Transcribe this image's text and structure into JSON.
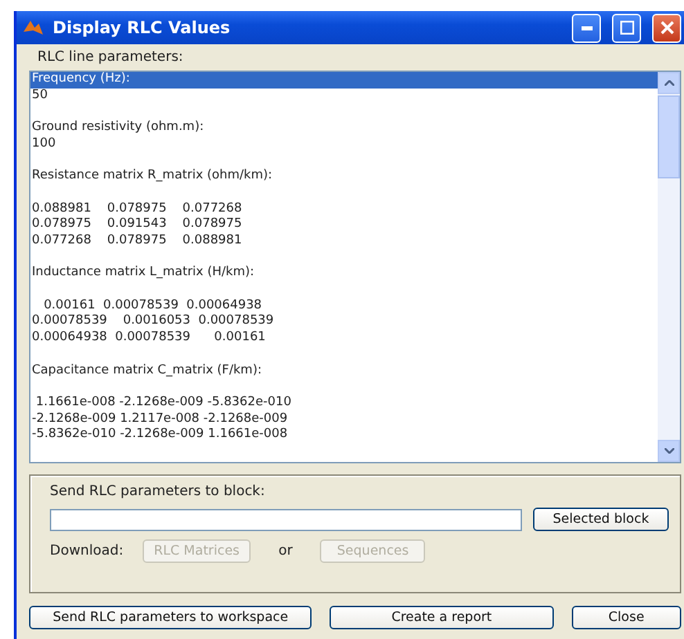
{
  "window": {
    "title": "Display RLC Values"
  },
  "listbox": {
    "label": "RLC line parameters:",
    "items": [
      {
        "text": "Frequency (Hz):",
        "selected": true,
        "space_before": false
      },
      {
        "text": "50",
        "selected": false,
        "space_before": false
      },
      {
        "text": "Ground resistivity (ohm.m):",
        "selected": false,
        "space_before": true
      },
      {
        "text": "100",
        "selected": false,
        "space_before": false
      },
      {
        "text": "Resistance matrix R_matrix (ohm/km):",
        "selected": false,
        "space_before": true
      },
      {
        "text": "0.088981    0.078975    0.077268",
        "selected": false,
        "space_before": true
      },
      {
        "text": "0.078975    0.091543    0.078975",
        "selected": false,
        "space_before": false
      },
      {
        "text": "0.077268    0.078975    0.088981",
        "selected": false,
        "space_before": false
      },
      {
        "text": "Inductance matrix L_matrix (H/km):",
        "selected": false,
        "space_before": true
      },
      {
        "text": "   0.00161  0.00078539  0.00064938",
        "selected": false,
        "space_before": true
      },
      {
        "text": "0.00078539    0.0016053  0.00078539",
        "selected": false,
        "space_before": false
      },
      {
        "text": "0.00064938  0.00078539      0.00161",
        "selected": false,
        "space_before": false
      },
      {
        "text": "Capacitance matrix C_matrix (F/km):",
        "selected": false,
        "space_before": true
      },
      {
        "text": " 1.1661e-008 -2.1268e-009 -5.8362e-010",
        "selected": false,
        "space_before": true
      },
      {
        "text": "-2.1268e-009 1.2117e-008 -2.1268e-009",
        "selected": false,
        "space_before": false
      },
      {
        "text": "-5.8362e-010 -2.1268e-009 1.1661e-008",
        "selected": false,
        "space_before": false
      }
    ]
  },
  "send_panel": {
    "label": "Send RLC parameters to block:",
    "selected_block_button": "Selected block",
    "download_label": "Download:",
    "or_label": "or",
    "download_buttons": [
      {
        "label": "RLC Matrices",
        "disabled": true
      },
      {
        "label": "Sequences",
        "disabled": true
      }
    ]
  },
  "buttons": [
    "Send RLC parameters to workspace",
    "Create a report",
    "Close"
  ]
}
